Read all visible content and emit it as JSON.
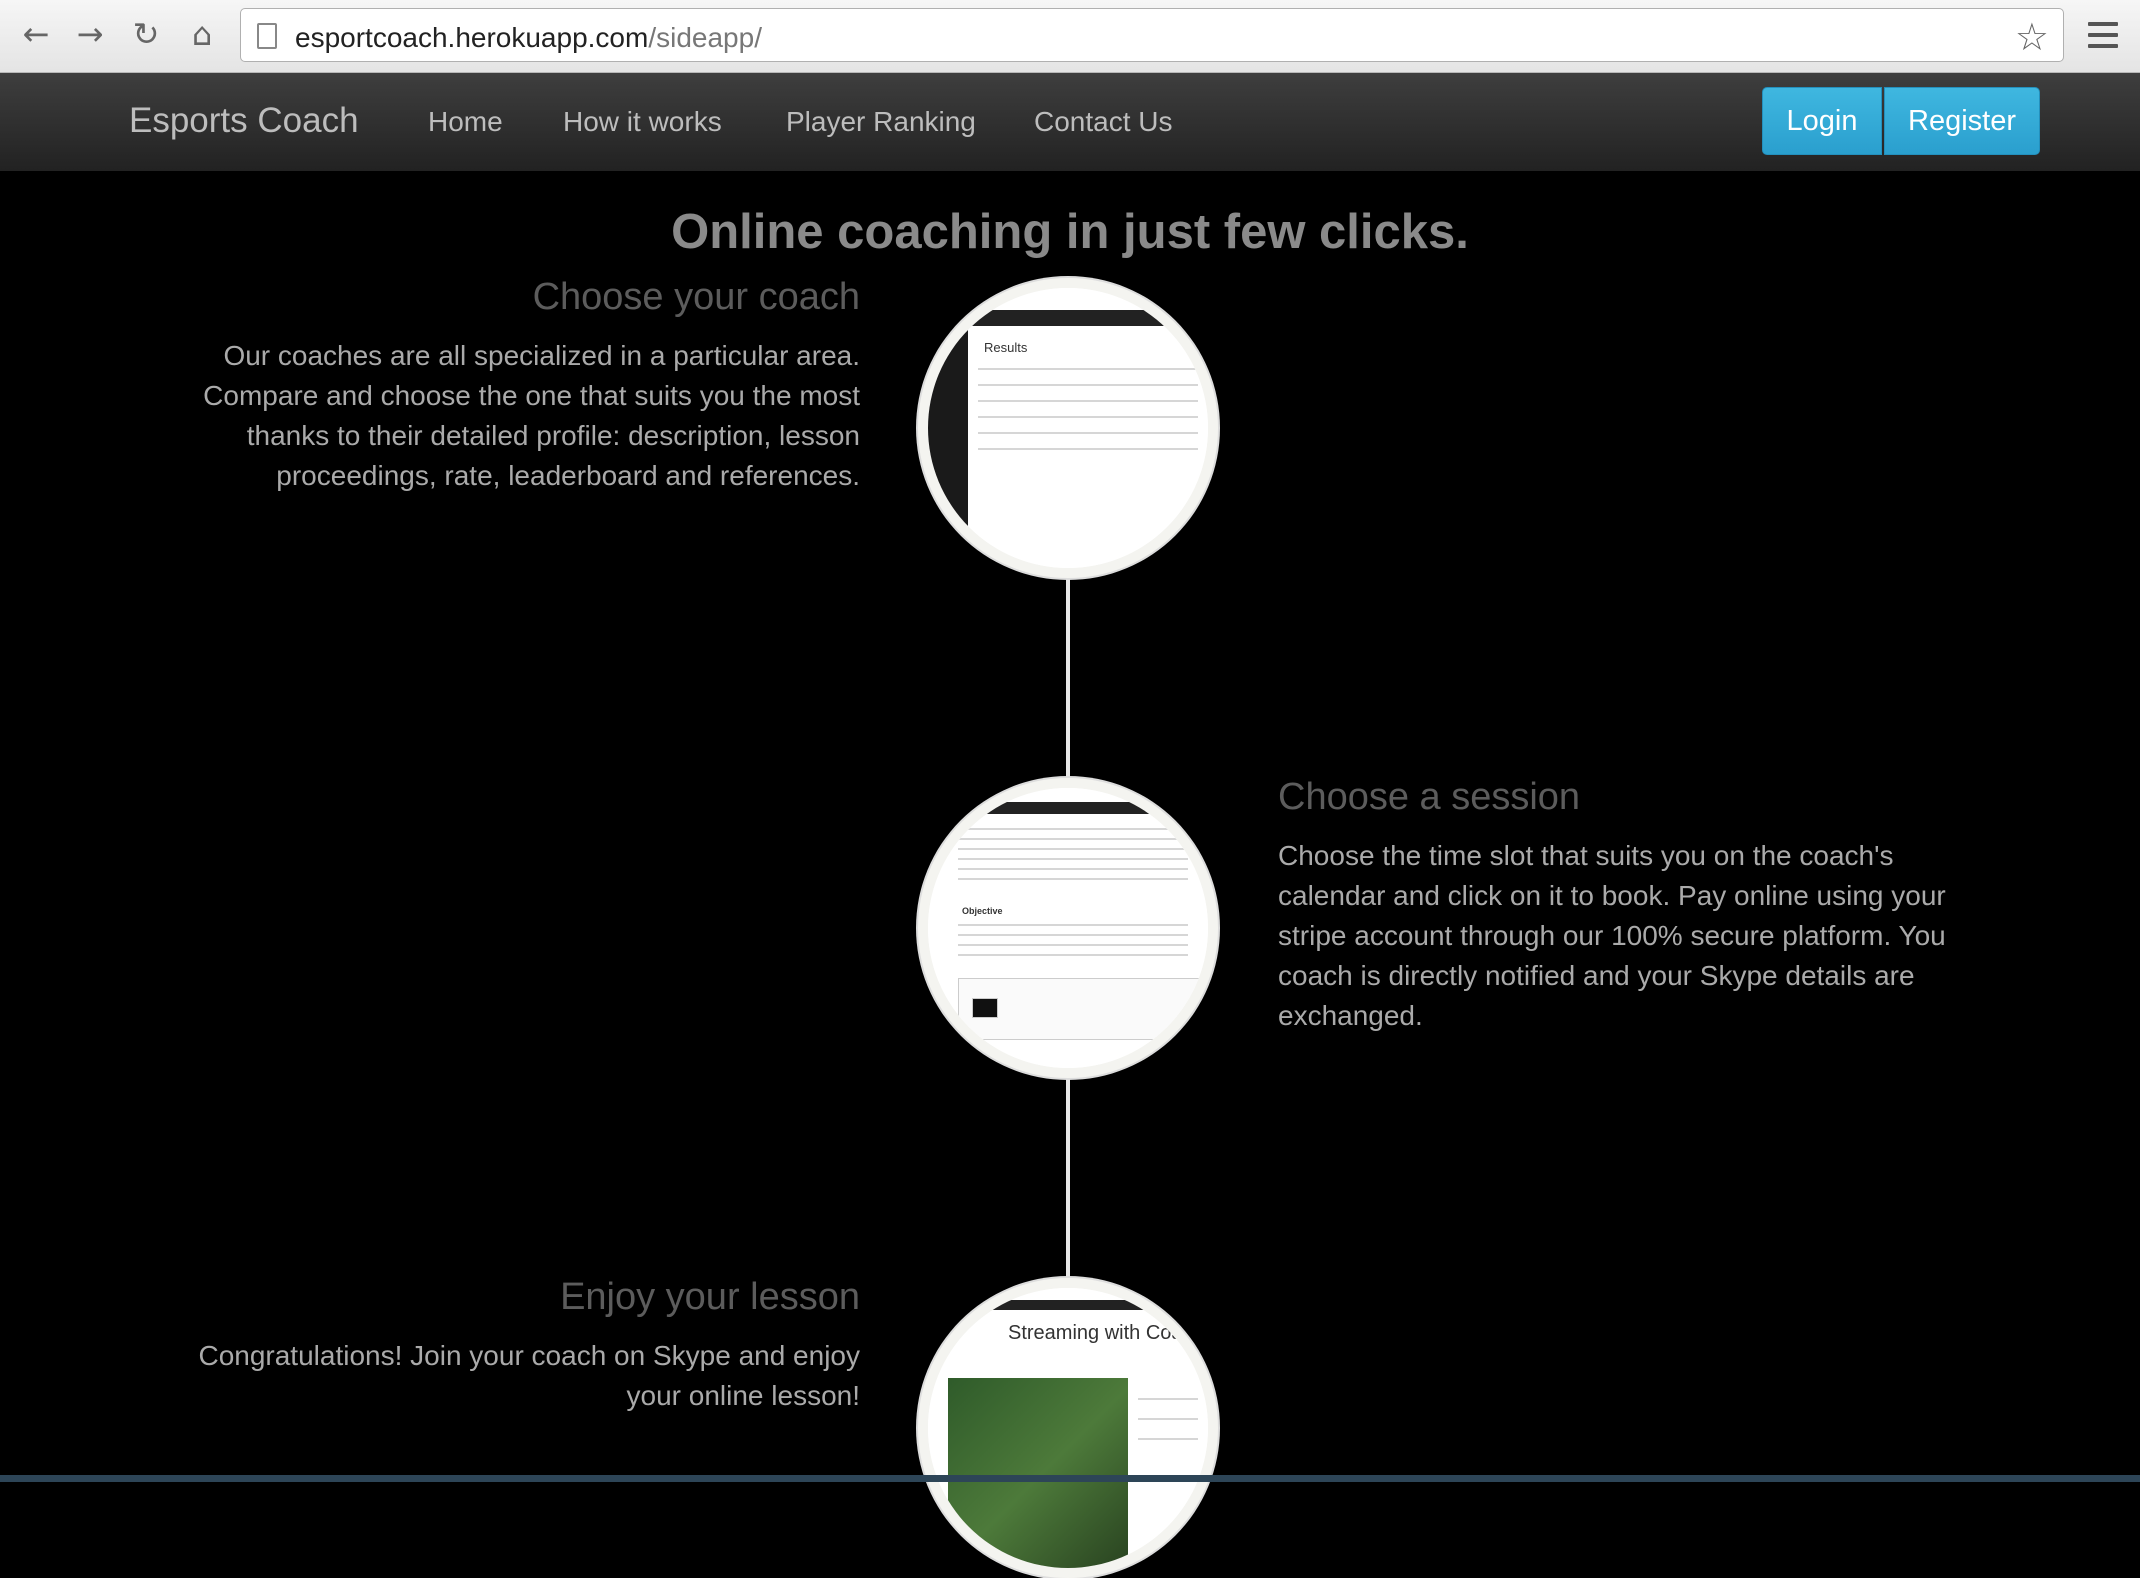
{
  "browser": {
    "url_host": "esportcoach.herokuapp.com",
    "url_path": "/sideapp/",
    "back_icon": "arrow-left",
    "forward_icon": "arrow-right",
    "reload_icon": "reload",
    "home_icon": "home",
    "star_icon": "star",
    "menu_icon": "hamburger"
  },
  "navbar": {
    "brand": "Esports Coach",
    "links": [
      "Home",
      "How it works",
      "Player Ranking",
      "Contact Us"
    ],
    "login": "Login",
    "register": "Register",
    "button_color": "#31aadb"
  },
  "main": {
    "headline": "Online coaching in just few clicks.",
    "steps": [
      {
        "title": "Choose your coach",
        "lines": [
          "Our coaches are all specialized in a particular area.",
          "Compare and choose the one that suits you the most",
          "thanks to their detailed profile: description, lesson",
          "proceedings, rate, leaderboard and references."
        ],
        "image_caption": "Results"
      },
      {
        "title": "Choose a session",
        "lines": [
          "Choose the time slot that suits you on the coach's",
          "calendar and click on it to book. Pay online using your",
          "stripe account through our 100% secure platform. You",
          "coach is directly notified and your Skype details are",
          "exchanged."
        ],
        "image_caption": "Objective"
      },
      {
        "title": "Enjoy your lesson",
        "lines": [
          "Congratulations! Join your coach on Skype and enjoy",
          "your online lesson!"
        ],
        "image_caption": "Streaming with Coa"
      }
    ]
  }
}
